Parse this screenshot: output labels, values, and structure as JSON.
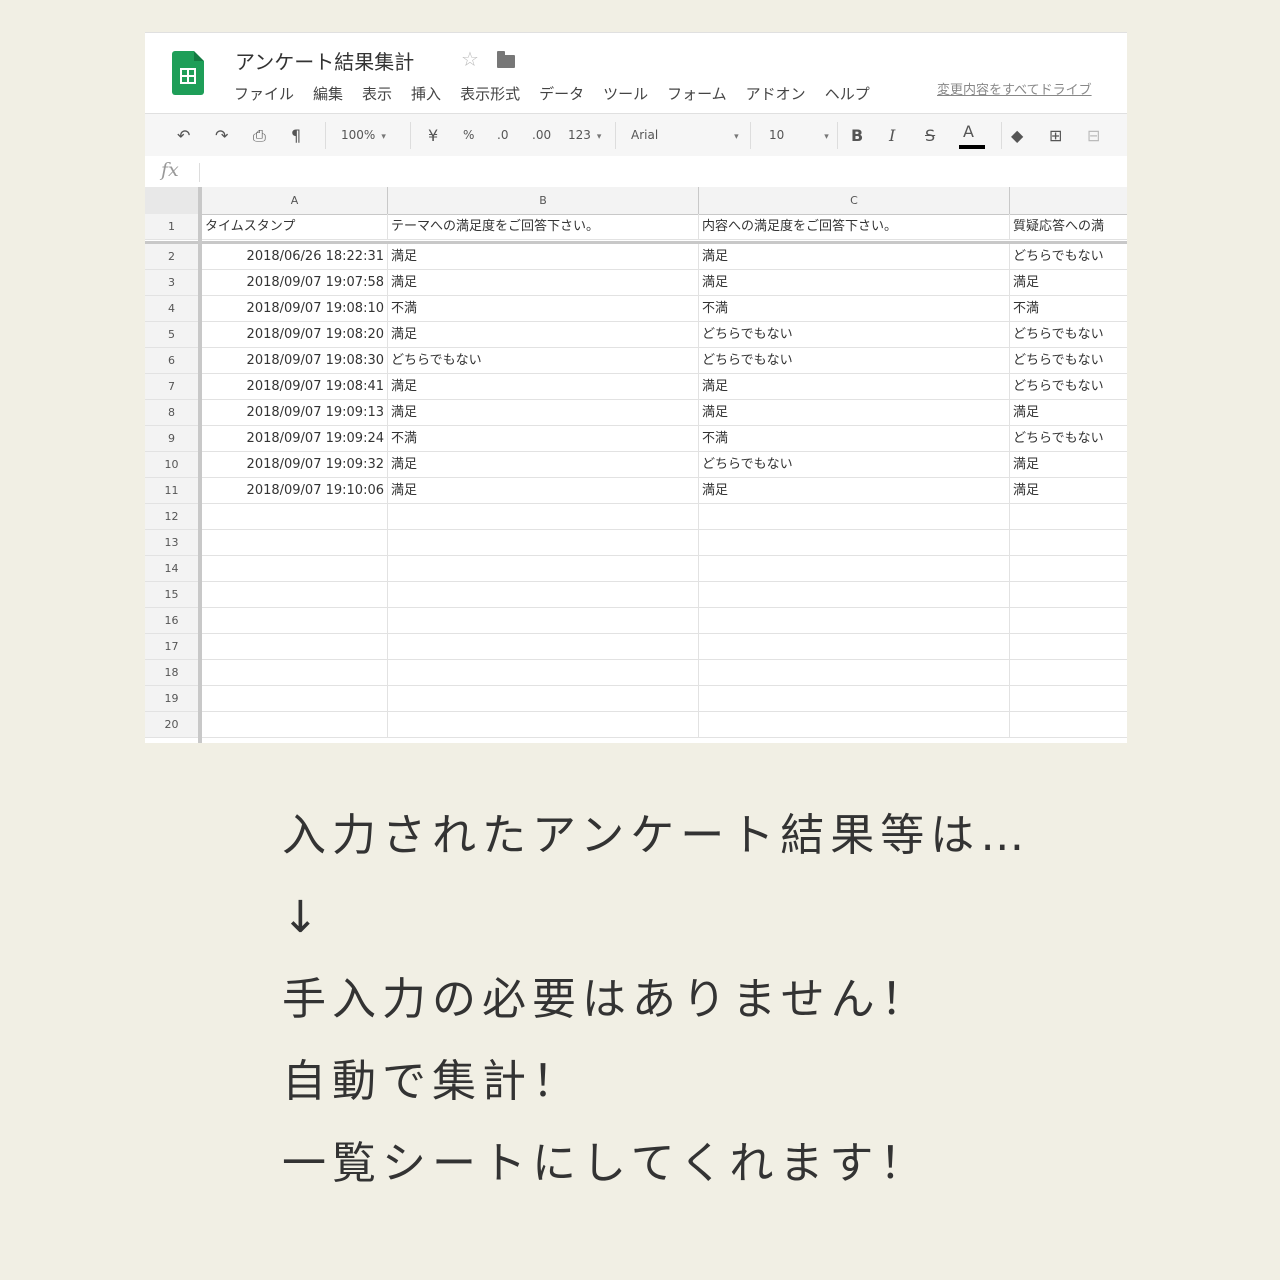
{
  "app": {
    "doc_title": "アンケート結果集計",
    "menu": [
      "ファイル",
      "編集",
      "表示",
      "挿入",
      "表示形式",
      "データ",
      "ツール",
      "フォーム",
      "アドオン",
      "ヘルプ"
    ],
    "save_status": "変更内容をすべてドライブ"
  },
  "toolbar": {
    "zoom": "100%",
    "currency": "¥",
    "percent": "%",
    "dec_decrease": ".0",
    "dec_increase": ".00",
    "format_more": "123",
    "font": "Arial",
    "font_size": "10",
    "bold": "B",
    "italic": "I",
    "strike": "S",
    "text_color": "A"
  },
  "formula_bar": {
    "label": "fx"
  },
  "sheet": {
    "columns": [
      "A",
      "B",
      "C"
    ],
    "header_row": [
      "タイムスタンプ",
      "テーマへの満足度をご回答下さい。",
      "内容への満足度をご回答下さい。",
      "質疑応答への満"
    ],
    "rows": [
      [
        "2018/06/26 18:22:31",
        "満足",
        "満足",
        "どちらでもない"
      ],
      [
        "2018/09/07 19:07:58",
        "満足",
        "満足",
        "満足"
      ],
      [
        "2018/09/07 19:08:10",
        "不満",
        "不満",
        "不満"
      ],
      [
        "2018/09/07 19:08:20",
        "満足",
        "どちらでもない",
        "どちらでもない"
      ],
      [
        "2018/09/07 19:08:30",
        "どちらでもない",
        "どちらでもない",
        "どちらでもない"
      ],
      [
        "2018/09/07 19:08:41",
        "満足",
        "満足",
        "どちらでもない"
      ],
      [
        "2018/09/07 19:09:13",
        "満足",
        "満足",
        "満足"
      ],
      [
        "2018/09/07 19:09:24",
        "不満",
        "不満",
        "どちらでもない"
      ],
      [
        "2018/09/07 19:09:32",
        "満足",
        "どちらでもない",
        "満足"
      ],
      [
        "2018/09/07 19:10:06",
        "満足",
        "満足",
        "満足"
      ]
    ],
    "row_numbers": [
      "1",
      "2",
      "3",
      "4",
      "5",
      "6",
      "7",
      "8",
      "9",
      "10",
      "11",
      "12",
      "13",
      "14",
      "15",
      "16",
      "17",
      "18",
      "19",
      "20"
    ]
  },
  "caption": {
    "lines": [
      "入力されたアンケート結果等は…",
      "↓",
      "手入力の必要はありません！",
      "自動で集計！",
      "一覧シートにしてくれます！"
    ]
  },
  "colors": {
    "background": "#f1efe4",
    "sheets_green": "#1e9e58"
  }
}
